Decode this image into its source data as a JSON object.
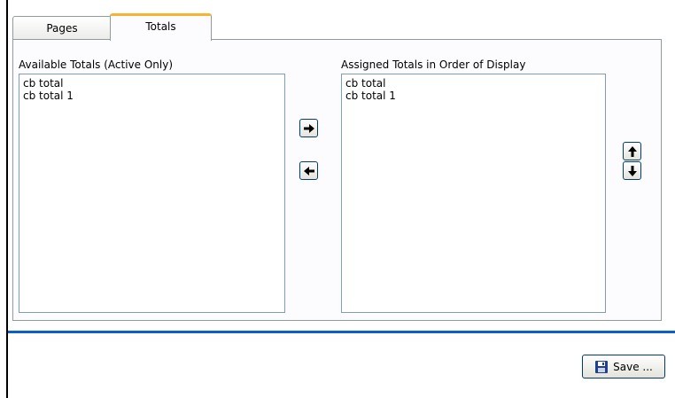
{
  "tabs": [
    {
      "label": "Pages",
      "selected": false
    },
    {
      "label": "Totals",
      "selected": true
    }
  ],
  "available": {
    "label": "Available Totals (Active Only)",
    "items": [
      "cb total",
      "cb total 1"
    ]
  },
  "assigned": {
    "label": "Assigned Totals in Order of Display",
    "items": [
      "cb total",
      "cb total 1"
    ]
  },
  "buttons": {
    "save_label": "Save ..."
  },
  "icons": {
    "add": "arrow-right-icon",
    "remove": "arrow-left-icon",
    "move_up": "arrow-up-icon",
    "move_down": "arrow-down-icon",
    "save": "floppy-disk-icon"
  },
  "colors": {
    "active_tab_accent": "#f8b330",
    "separator": "#0a5fc8",
    "button_border": "#003c74",
    "listbox_border": "#7f9db9"
  }
}
